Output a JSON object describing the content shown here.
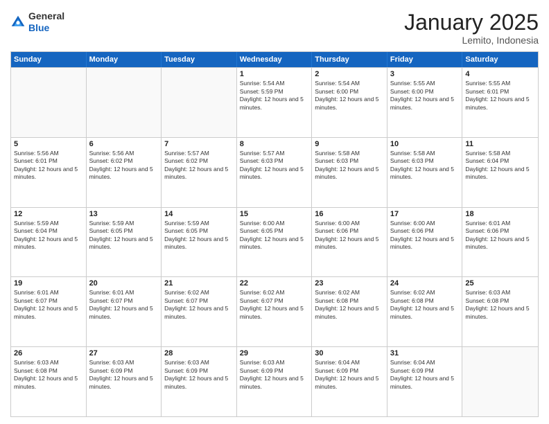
{
  "logo": {
    "general": "General",
    "blue": "Blue"
  },
  "header": {
    "month": "January 2025",
    "location": "Lemito, Indonesia"
  },
  "weekdays": [
    "Sunday",
    "Monday",
    "Tuesday",
    "Wednesday",
    "Thursday",
    "Friday",
    "Saturday"
  ],
  "weeks": [
    [
      {
        "day": "",
        "sunrise": "",
        "sunset": "",
        "daylight": ""
      },
      {
        "day": "",
        "sunrise": "",
        "sunset": "",
        "daylight": ""
      },
      {
        "day": "",
        "sunrise": "",
        "sunset": "",
        "daylight": ""
      },
      {
        "day": "1",
        "sunrise": "Sunrise: 5:54 AM",
        "sunset": "Sunset: 5:59 PM",
        "daylight": "Daylight: 12 hours and 5 minutes."
      },
      {
        "day": "2",
        "sunrise": "Sunrise: 5:54 AM",
        "sunset": "Sunset: 6:00 PM",
        "daylight": "Daylight: 12 hours and 5 minutes."
      },
      {
        "day": "3",
        "sunrise": "Sunrise: 5:55 AM",
        "sunset": "Sunset: 6:00 PM",
        "daylight": "Daylight: 12 hours and 5 minutes."
      },
      {
        "day": "4",
        "sunrise": "Sunrise: 5:55 AM",
        "sunset": "Sunset: 6:01 PM",
        "daylight": "Daylight: 12 hours and 5 minutes."
      }
    ],
    [
      {
        "day": "5",
        "sunrise": "Sunrise: 5:56 AM",
        "sunset": "Sunset: 6:01 PM",
        "daylight": "Daylight: 12 hours and 5 minutes."
      },
      {
        "day": "6",
        "sunrise": "Sunrise: 5:56 AM",
        "sunset": "Sunset: 6:02 PM",
        "daylight": "Daylight: 12 hours and 5 minutes."
      },
      {
        "day": "7",
        "sunrise": "Sunrise: 5:57 AM",
        "sunset": "Sunset: 6:02 PM",
        "daylight": "Daylight: 12 hours and 5 minutes."
      },
      {
        "day": "8",
        "sunrise": "Sunrise: 5:57 AM",
        "sunset": "Sunset: 6:03 PM",
        "daylight": "Daylight: 12 hours and 5 minutes."
      },
      {
        "day": "9",
        "sunrise": "Sunrise: 5:58 AM",
        "sunset": "Sunset: 6:03 PM",
        "daylight": "Daylight: 12 hours and 5 minutes."
      },
      {
        "day": "10",
        "sunrise": "Sunrise: 5:58 AM",
        "sunset": "Sunset: 6:03 PM",
        "daylight": "Daylight: 12 hours and 5 minutes."
      },
      {
        "day": "11",
        "sunrise": "Sunrise: 5:58 AM",
        "sunset": "Sunset: 6:04 PM",
        "daylight": "Daylight: 12 hours and 5 minutes."
      }
    ],
    [
      {
        "day": "12",
        "sunrise": "Sunrise: 5:59 AM",
        "sunset": "Sunset: 6:04 PM",
        "daylight": "Daylight: 12 hours and 5 minutes."
      },
      {
        "day": "13",
        "sunrise": "Sunrise: 5:59 AM",
        "sunset": "Sunset: 6:05 PM",
        "daylight": "Daylight: 12 hours and 5 minutes."
      },
      {
        "day": "14",
        "sunrise": "Sunrise: 5:59 AM",
        "sunset": "Sunset: 6:05 PM",
        "daylight": "Daylight: 12 hours and 5 minutes."
      },
      {
        "day": "15",
        "sunrise": "Sunrise: 6:00 AM",
        "sunset": "Sunset: 6:05 PM",
        "daylight": "Daylight: 12 hours and 5 minutes."
      },
      {
        "day": "16",
        "sunrise": "Sunrise: 6:00 AM",
        "sunset": "Sunset: 6:06 PM",
        "daylight": "Daylight: 12 hours and 5 minutes."
      },
      {
        "day": "17",
        "sunrise": "Sunrise: 6:00 AM",
        "sunset": "Sunset: 6:06 PM",
        "daylight": "Daylight: 12 hours and 5 minutes."
      },
      {
        "day": "18",
        "sunrise": "Sunrise: 6:01 AM",
        "sunset": "Sunset: 6:06 PM",
        "daylight": "Daylight: 12 hours and 5 minutes."
      }
    ],
    [
      {
        "day": "19",
        "sunrise": "Sunrise: 6:01 AM",
        "sunset": "Sunset: 6:07 PM",
        "daylight": "Daylight: 12 hours and 5 minutes."
      },
      {
        "day": "20",
        "sunrise": "Sunrise: 6:01 AM",
        "sunset": "Sunset: 6:07 PM",
        "daylight": "Daylight: 12 hours and 5 minutes."
      },
      {
        "day": "21",
        "sunrise": "Sunrise: 6:02 AM",
        "sunset": "Sunset: 6:07 PM",
        "daylight": "Daylight: 12 hours and 5 minutes."
      },
      {
        "day": "22",
        "sunrise": "Sunrise: 6:02 AM",
        "sunset": "Sunset: 6:07 PM",
        "daylight": "Daylight: 12 hours and 5 minutes."
      },
      {
        "day": "23",
        "sunrise": "Sunrise: 6:02 AM",
        "sunset": "Sunset: 6:08 PM",
        "daylight": "Daylight: 12 hours and 5 minutes."
      },
      {
        "day": "24",
        "sunrise": "Sunrise: 6:02 AM",
        "sunset": "Sunset: 6:08 PM",
        "daylight": "Daylight: 12 hours and 5 minutes."
      },
      {
        "day": "25",
        "sunrise": "Sunrise: 6:03 AM",
        "sunset": "Sunset: 6:08 PM",
        "daylight": "Daylight: 12 hours and 5 minutes."
      }
    ],
    [
      {
        "day": "26",
        "sunrise": "Sunrise: 6:03 AM",
        "sunset": "Sunset: 6:08 PM",
        "daylight": "Daylight: 12 hours and 5 minutes."
      },
      {
        "day": "27",
        "sunrise": "Sunrise: 6:03 AM",
        "sunset": "Sunset: 6:09 PM",
        "daylight": "Daylight: 12 hours and 5 minutes."
      },
      {
        "day": "28",
        "sunrise": "Sunrise: 6:03 AM",
        "sunset": "Sunset: 6:09 PM",
        "daylight": "Daylight: 12 hours and 5 minutes."
      },
      {
        "day": "29",
        "sunrise": "Sunrise: 6:03 AM",
        "sunset": "Sunset: 6:09 PM",
        "daylight": "Daylight: 12 hours and 5 minutes."
      },
      {
        "day": "30",
        "sunrise": "Sunrise: 6:04 AM",
        "sunset": "Sunset: 6:09 PM",
        "daylight": "Daylight: 12 hours and 5 minutes."
      },
      {
        "day": "31",
        "sunrise": "Sunrise: 6:04 AM",
        "sunset": "Sunset: 6:09 PM",
        "daylight": "Daylight: 12 hours and 5 minutes."
      },
      {
        "day": "",
        "sunrise": "",
        "sunset": "",
        "daylight": ""
      }
    ]
  ]
}
